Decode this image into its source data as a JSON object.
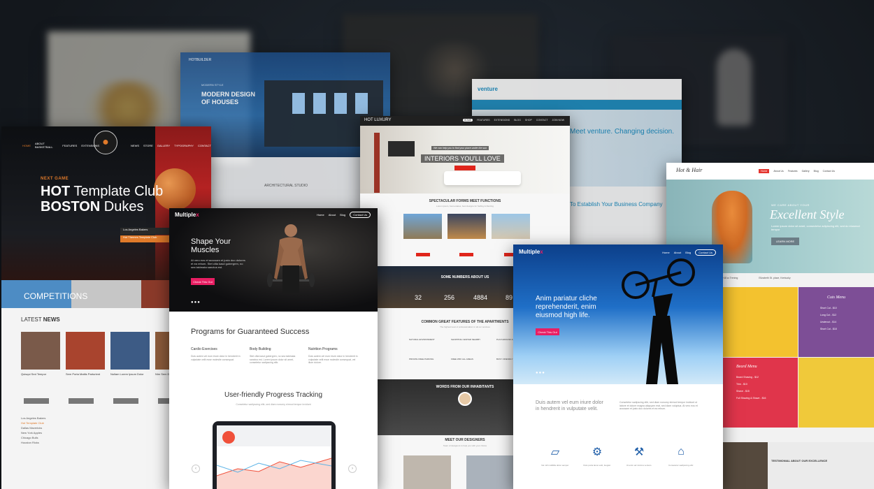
{
  "basketball": {
    "nav": [
      "HOME",
      "ABOUT BASKETBALL",
      "FEATURES",
      "EXTENSIONS",
      "NEWS",
      "STORE",
      "GALLERY",
      "TYPOGRAPHY",
      "CONTACT"
    ],
    "next_game": "NEXT GAME",
    "headline_1_bold": "HOT",
    "headline_1_rest": " Template Club",
    "headline_2_bold": "BOSTON",
    "headline_2_rest": " Dukes",
    "team_1": "Los Angeles Bakers",
    "team_2": "Hot Themes Template Club",
    "tile_label": "COMPETITIONS",
    "news_prefix": "LATEST",
    "news_bold": "NEWS",
    "thumb_captions": [
      "Quisqui Sed Tempor",
      "Sem Porta Mattis Parturient",
      "Nullam Lorem Ipsum Dolor",
      "Nim Sem Dui"
    ],
    "table_rows": [
      "Los Angeles Bakers",
      "Hot Template Club",
      "Dallas Mavericks",
      "New York Apples",
      "Chicago Bulls",
      "Houston Ricks"
    ]
  },
  "house": {
    "logo": "HOTBUILDER",
    "subtitle": "MODERN STYLE",
    "headline": "MODERN DESIGN OF HOUSES",
    "arch": "ARCHITECTURAL STUDIO"
  },
  "venture": {
    "logo": "venture",
    "hero_text": "Meet venture. Changing decision.",
    "lower_text": "To Establish Your Business Company"
  },
  "multiplex_fitness": {
    "logo_a": "Multiple",
    "logo_b": "x",
    "nav": [
      "Home",
      "About",
      "Blog"
    ],
    "contact": "Contact Us",
    "title": "Shape Your Muscles",
    "desc": "At vero eos et accusam et justo duo dolores et ea rebum. Stet clita kasd gubergren, no sea takimata sanctus est.",
    "button": "Check This Out",
    "dots": "●●●",
    "programs_title": "Programs for Guaranteed Success",
    "columns": [
      {
        "title": "Cardio Exercises",
        "text": "Duis autem vel eum iriure dolor in hendrerit in vulputate velit esse molestie consequat."
      },
      {
        "title": "Body Building",
        "text": "Stet clita kasd gubergren, no sea takimata sanctus est. Lorem ipsum dolor sit amet, consetetur sadipscing elitr."
      },
      {
        "title": "Nutrition Programs",
        "text": "Duis autem vel eum iriure dolor in hendrerit in vulputate velit esse molestie consequat, vel illum dolore."
      }
    ],
    "tracking_title": "User-friendly Progress Tracking",
    "tracking_sub": "Consetetur sadipscing elitr, sed diam nonumy eirmod tempor invidunt",
    "prev": "‹",
    "next": "›"
  },
  "hot_luxury": {
    "logo": "HOT LUXURY",
    "nav": [
      "HOME",
      "FEATURES",
      "EXTENSIONS",
      "BLOG",
      "SHOP",
      "CONTACT",
      "JOIN NOW"
    ],
    "tagline": "We can help you to find your place under the sun",
    "hero_title": "INTERIORS YOU'LL LOVE",
    "section_1": "SPECTACULAR FORMS MEET FUNCTIONS",
    "section_1_sub": "Lorem ipsum, best estates, best designs for Selling & Renting",
    "numbers_title": "SOME NUMBERS ABOUT US",
    "numbers": [
      "32",
      "256",
      "4884",
      "89"
    ],
    "section_2": "COMMON GREAT FEATURES OF THE APARTMENTS",
    "section_2_sub": "The highest level of professionalism in all our services",
    "features": [
      "NATURAL ENVIRONMENT",
      "SHOPPING CENTER NEARBY",
      "PLAYGROUND & LIBRARY",
      "PRIVATE FREE PARKING",
      "FREE WIFI ALL AREAS",
      "BUSY FRIENDLY PUBLIC"
    ],
    "words_title": "WORDS FROM OUR INHABITANTS",
    "designers_title": "MEET OUR DESIGNERS",
    "designers_sub": "Team of designers to help you with your choice"
  },
  "hair": {
    "logo": "Hot & Hair",
    "nav": [
      "Home",
      "About Us",
      "Features",
      "Gallery",
      "Blog",
      "Contact Us"
    ],
    "small": "WE CARE ABOUT YOUR",
    "big": "Excellent Style",
    "para": "Lorem ipsum dolor sit amet, consectetur adipiscing elit, sed do eiusmod tempor",
    "button": "LEARN MORE",
    "info": [
      "+48 w-Trening",
      "Elizabeth St. place, Kentucky"
    ],
    "cuts_title": "Cuts Menu",
    "cuts_items": [
      "Short Cut - $10",
      "Long Cut - $12",
      "Undercut - $14",
      "Short Cut - $18"
    ],
    "beard_title": "Beard Menu",
    "beard_items": [
      "Beard Shaving - $12",
      "Trim - $10",
      "Shave - $15",
      "Full Shaving & Shave - $16"
    ],
    "testimonial": "TESTIMONIAL ABOUT OUR EXCELLENCE"
  },
  "multiplex_bike": {
    "logo_a": "Multiple",
    "logo_b": "x",
    "nav": [
      "Home",
      "About",
      "Blog"
    ],
    "contact": "Contact Us",
    "headline": "Anim pariatur cliche reprehenderit, enim eiusmod high life.",
    "button": "Check This Out",
    "dots": "●●●",
    "lead": "Duis autem vel eum iriure dolor in hendrerit in vulputate velit.",
    "para": "Consetetur sadipscing elitr, sed diam nonumy eirmod tempor invidunt ut labore et dolore magna aliquyam erat, sed diam voluptua. At vero eos et accusam et justo duo dolores et ea rebum.",
    "icon_texts": [
      "Vel mill mollitilla dolor semper.",
      "Duis porta lacus velit, feugiat.",
      "Ut enim ad minima veniam.",
      "Consetetur sadipscing elitr."
    ]
  }
}
